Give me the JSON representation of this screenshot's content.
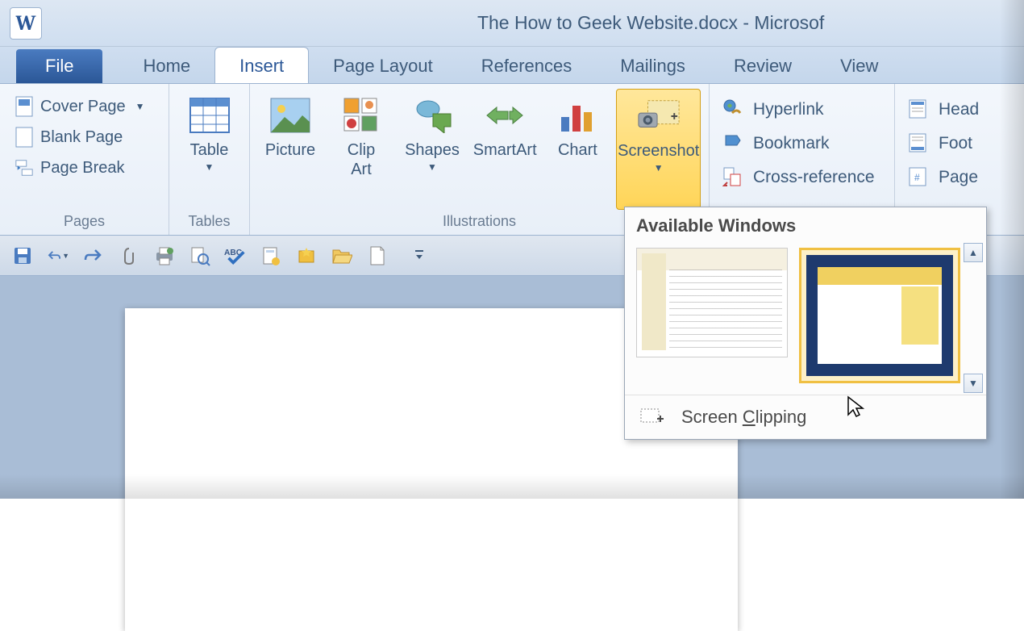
{
  "title": "The How to Geek Website.docx - Microsof",
  "app_letter": "W",
  "tabs": {
    "file": "File",
    "home": "Home",
    "insert": "Insert",
    "page_layout": "Page Layout",
    "references": "References",
    "mailings": "Mailings",
    "review": "Review",
    "view": "View"
  },
  "groups": {
    "pages": {
      "label": "Pages",
      "cover_page": "Cover Page",
      "blank_page": "Blank Page",
      "page_break": "Page Break"
    },
    "tables": {
      "label": "Tables",
      "table": "Table"
    },
    "illustrations": {
      "label": "Illustrations",
      "picture": "Picture",
      "clip_art": "Clip\nArt",
      "shapes": "Shapes",
      "smartart": "SmartArt",
      "chart": "Chart",
      "screenshot": "Screenshot"
    },
    "links": {
      "hyperlink": "Hyperlink",
      "bookmark": "Bookmark",
      "cross_reference": "Cross-reference"
    },
    "header_footer": {
      "header": "Head",
      "footer": "Foot",
      "page_number": "Page"
    }
  },
  "dropdown": {
    "header": "Available Windows",
    "screen_clipping": "Screen Clipping"
  }
}
